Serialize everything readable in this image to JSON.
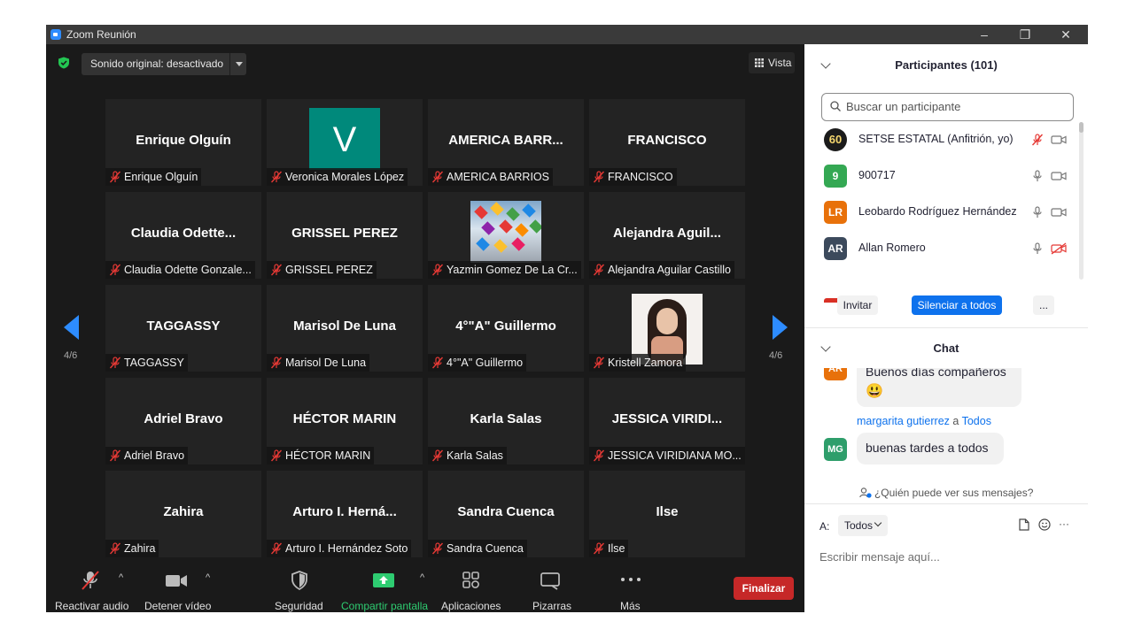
{
  "window": {
    "title": "Zoom Reunión",
    "controls": [
      "–",
      "❐",
      "✕"
    ]
  },
  "meeting": {
    "sound_button": "Sonido original: desactivado",
    "view_button": "Vista",
    "page_left": "4/6",
    "page_right": "4/6",
    "tiles": [
      {
        "big": "Enrique Olguín",
        "name": "Enrique Olguín"
      },
      {
        "big": "V",
        "name": "Veronica Morales López",
        "avatar": "V",
        "avatar_color": "#00897b"
      },
      {
        "big": "AMERICA BARR...",
        "name": "AMERICA BARRIOS"
      },
      {
        "big": "FRANCISCO",
        "name": "FRANCISCO"
      },
      {
        "big": "Claudia  Odette...",
        "name": "Claudia Odette Gonzale..."
      },
      {
        "big": "GRISSEL PEREZ",
        "name": "GRISSEL PEREZ"
      },
      {
        "big": "",
        "name": "Yazmin Gomez De La Cr..."
      },
      {
        "big": "Alejandra  Aguil...",
        "name": "Alejandra Aguilar Castillo"
      },
      {
        "big": "TAGGASSY",
        "name": "TAGGASSY"
      },
      {
        "big": "Marisol De Luna",
        "name": "Marisol De Luna"
      },
      {
        "big": "4°\"A\" Guillermo",
        "name": "4°\"A\" Guillermo"
      },
      {
        "big": "",
        "name": "Kristell Zamora"
      },
      {
        "big": "Adriel Bravo",
        "name": "Adriel Bravo"
      },
      {
        "big": "HÉCTOR MARIN",
        "name": "HÉCTOR MARIN"
      },
      {
        "big": "Karla Salas",
        "name": "Karla Salas"
      },
      {
        "big": "JESSICA  VIRIDI...",
        "name": "JESSICA VIRIDIANA MO..."
      },
      {
        "big": "Zahira",
        "name": "Zahira"
      },
      {
        "big": "Arturo  I.  Herná...",
        "name": "Arturo I. Hernández Soto"
      },
      {
        "big": "Sandra Cuenca",
        "name": "Sandra Cuenca"
      },
      {
        "big": "Ilse",
        "name": "Ilse"
      }
    ]
  },
  "toolbar": {
    "audio": "Reactivar audio",
    "video": "Detener vídeo",
    "security": "Seguridad",
    "share": "Compartir pantalla",
    "apps": "Aplicaciones",
    "whiteboards": "Pizarras",
    "more": "Más",
    "end": "Finalizar",
    "caret": "^"
  },
  "participants": {
    "header": "Participantes (101)",
    "search_placeholder": "Buscar un participante",
    "list": [
      {
        "initials": "60",
        "name": "SETSE ESTATAL (Anfitrión, yo)",
        "color": "#1b1b1b"
      },
      {
        "initials": "9",
        "name": "900717",
        "color": "#34a853"
      },
      {
        "initials": "LR",
        "name": "Leobardo Rodríguez Hernández",
        "color": "#e8710a"
      },
      {
        "initials": "AR",
        "name": "Allan Romero",
        "color": "#3c4a5c"
      }
    ],
    "invite": "Invitar",
    "mute_all": "Silenciar a todos",
    "more": "..."
  },
  "chat": {
    "header": "Chat",
    "messages": [
      {
        "initials": "AR",
        "text": "Buenos días compañeros",
        "emoji": "😃",
        "color": "#e8710a"
      },
      {
        "initials": "MG",
        "sender": "margarita gutierrez",
        "to_word": "a",
        "to": "Todos",
        "text": "buenas tardes a todos",
        "color": "#2e9e6b"
      }
    ],
    "visibility": "¿Quién puede ver sus mensajes?",
    "to_label": "A:",
    "to_value": "Todos",
    "input_placeholder": "Escribir mensaje aquí...",
    "more": "···"
  },
  "colors": {
    "accent": "#0e72ed",
    "share_green": "#2ecc71",
    "end_red": "#c62828",
    "muted_red": "#e53935"
  }
}
